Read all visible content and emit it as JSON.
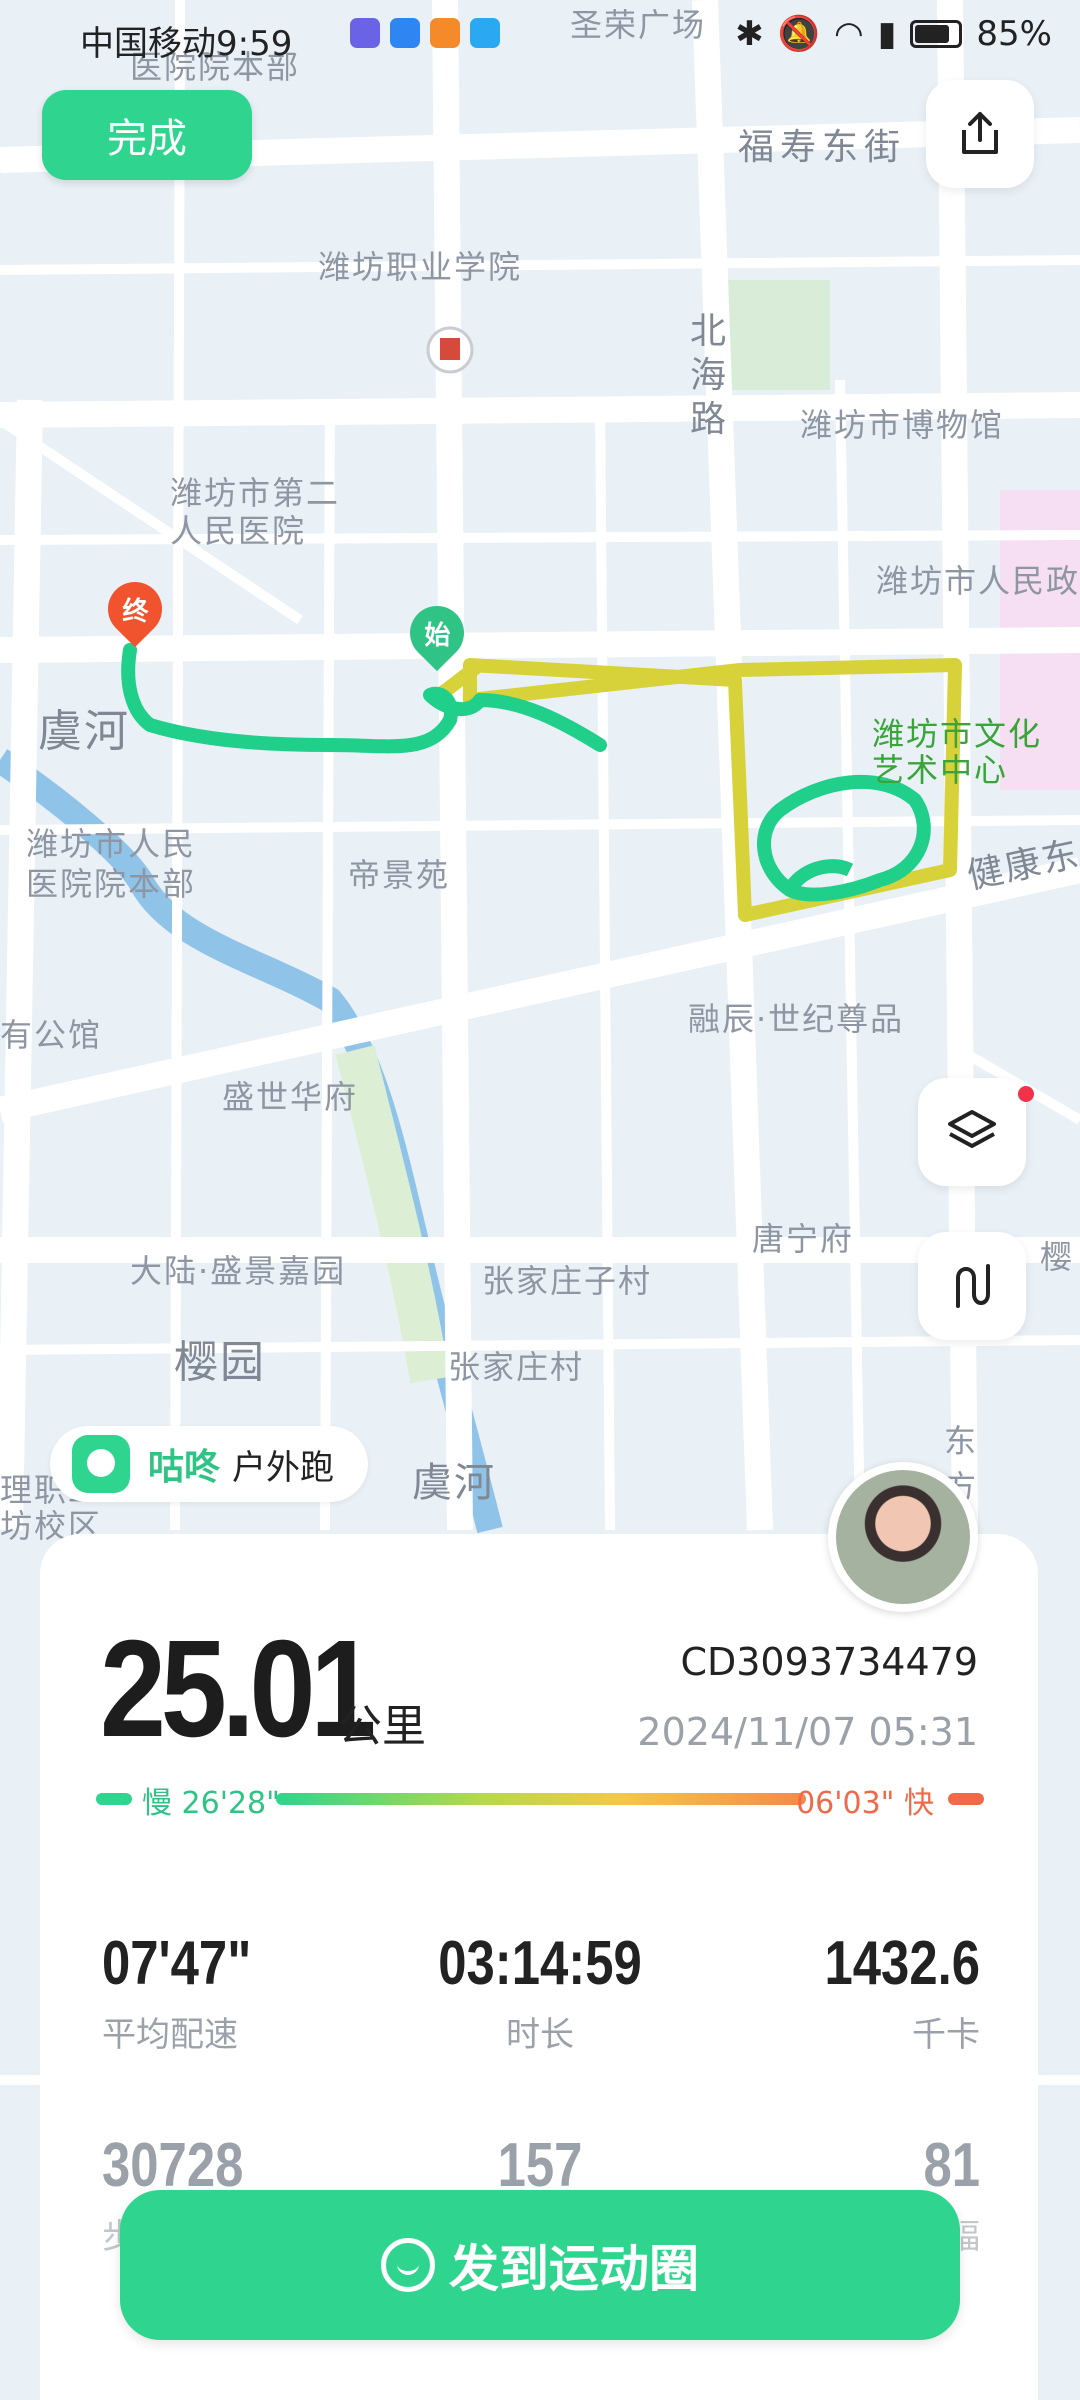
{
  "status_bar": {
    "carrier": "中国移动",
    "time": "9:59",
    "battery": "85%"
  },
  "toolbar": {
    "done_label": "完成"
  },
  "map": {
    "labels": {
      "hospital_top": "医院院本部",
      "shengrong": "圣荣广场",
      "fushou": "福寿东街",
      "vocational": "潍坊职业学院",
      "beihai": "北海路",
      "museum": "潍坊市博物馆",
      "hospital2": "潍坊市第二人民医院",
      "hospital_people": "潍坊市人民政",
      "yuhe": "虞河",
      "culture": "潍坊市文化艺术中心",
      "jiankang": "健康东",
      "hospital_main": "潍坊市人民医院院本部",
      "dijing": "帝景苑",
      "rongchen": "融辰·世纪尊品",
      "gongguan": "有公馆",
      "shengshi": "盛世华府",
      "tangning": "唐宁府",
      "dalu": "大陆·盛景嘉园",
      "zhangjia_zi": "张家庄子村",
      "ying": "樱",
      "yingyuan": "樱园",
      "zhangjia": "张家庄村",
      "dong": "东方",
      "yuhe2": "虞河",
      "school": "理职工坊校区"
    },
    "start_pin": "始",
    "end_pin": "终"
  },
  "app_badge": {
    "brand": "咕咚",
    "sport": "户外跑"
  },
  "summary": {
    "distance": "25.01",
    "distance_unit": "公里",
    "record_id": "CD3093734479",
    "datetime": "2024/11/07 05:31",
    "pace_slow": "慢 26'28\"",
    "pace_fast": "06'03\" 快"
  },
  "stats": [
    {
      "value": "07'47\"",
      "label": "平均配速"
    },
    {
      "value": "03:14:59",
      "label": "时长"
    },
    {
      "value": "1432.6",
      "label": "千卡"
    },
    {
      "value": "30728",
      "label": "步"
    },
    {
      "value": "157",
      "label": ""
    },
    {
      "value": "81",
      "label": "幅"
    }
  ],
  "share_label": "发到运动圈",
  "colors": {
    "accent": "#2fd48e",
    "route_green": "#1fcf8a",
    "route_yellow": "#d8d23a",
    "start_pin": "#2fc486",
    "end_pin": "#f0532e"
  }
}
